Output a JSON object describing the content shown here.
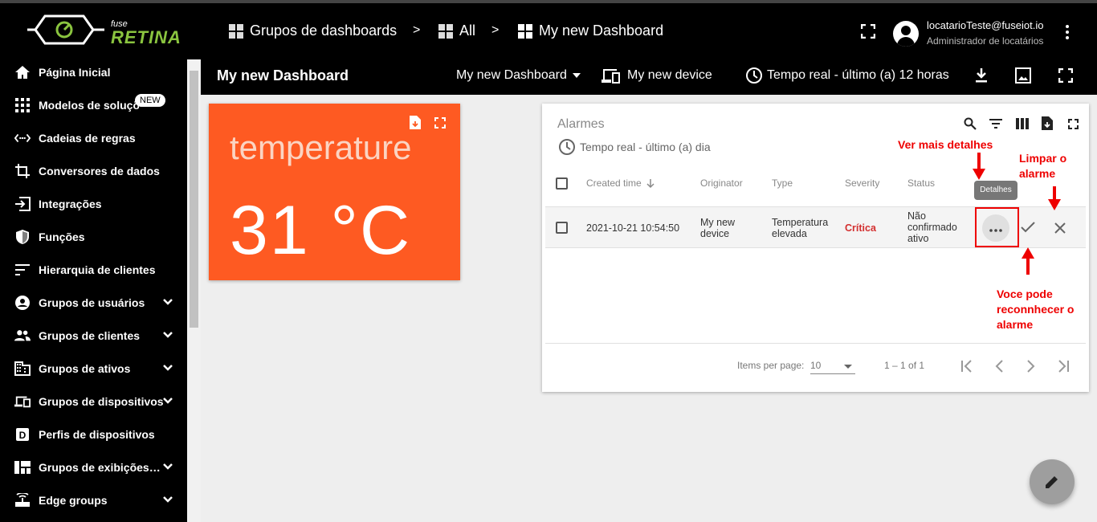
{
  "header": {
    "logo_small": "fuse",
    "logo_brand": "RETINA",
    "breadcrumb": [
      "Grupos de dashboards",
      "All",
      "My new Dashboard"
    ],
    "separator": ">",
    "user_email": "locatarioTeste@fuseiot.io",
    "user_role": "Administrador de locatários"
  },
  "sidebar": {
    "items": [
      {
        "label": "Página Inicial",
        "icon": "home-icon"
      },
      {
        "label": "Modelos de soluções",
        "icon": "grid-icon",
        "badge": "NEW"
      },
      {
        "label": "Cadeias de regras",
        "icon": "rule-chain-icon"
      },
      {
        "label": "Conversores de dados",
        "icon": "crop-icon"
      },
      {
        "label": "Integrações",
        "icon": "input-icon"
      },
      {
        "label": "Funções",
        "icon": "shield-icon"
      },
      {
        "label": "Hierarquia de clientes",
        "icon": "sort-icon"
      },
      {
        "label": "Grupos de usuários",
        "icon": "account-circle-icon",
        "expandable": true
      },
      {
        "label": "Grupos de clientes",
        "icon": "people-icon",
        "expandable": true
      },
      {
        "label": "Grupos de ativos",
        "icon": "domain-icon",
        "expandable": true
      },
      {
        "label": "Grupos de dispositivos",
        "icon": "devices-icon",
        "expandable": true
      },
      {
        "label": "Perfis de dispositivos",
        "icon": "device-profile-icon"
      },
      {
        "label": "Grupos de exibições de entidades",
        "icon": "view-quilt-icon",
        "expandable": true
      },
      {
        "label": "Edge groups",
        "icon": "router-icon",
        "expandable": true
      }
    ]
  },
  "dashboard": {
    "title": "My new Dashboard",
    "selector": "My new Dashboard",
    "device": "My new device",
    "timewindow": "Tempo real - último (a) 12 horas"
  },
  "temperature_widget": {
    "title": "temperature",
    "value": "31 °C",
    "bg_color": "#fe5a22"
  },
  "alarm_widget": {
    "title": "Alarmes",
    "timewindow": "Tempo real - último (a) dia",
    "columns": [
      "Created time",
      "Originator",
      "Type",
      "Severity",
      "Status"
    ],
    "rows": [
      {
        "created_time": "2021-10-21 10:54:50",
        "originator": [
          "My new",
          "device"
        ],
        "type": [
          "Temperatura",
          "elevada"
        ],
        "severity": "Crítica",
        "status": [
          "Não",
          "confirmado",
          "ativo"
        ]
      }
    ],
    "tooltip": "Detalhes",
    "items_per_page_label": "Items per page:",
    "items_per_page": "10",
    "range": "1 – 1 of 1"
  },
  "annotations": {
    "details": "Ver mais detalhes",
    "clear": [
      "Limpar o",
      "alarme"
    ],
    "ack": [
      "Voce pode",
      "reconnhecer o",
      "alarme"
    ]
  }
}
